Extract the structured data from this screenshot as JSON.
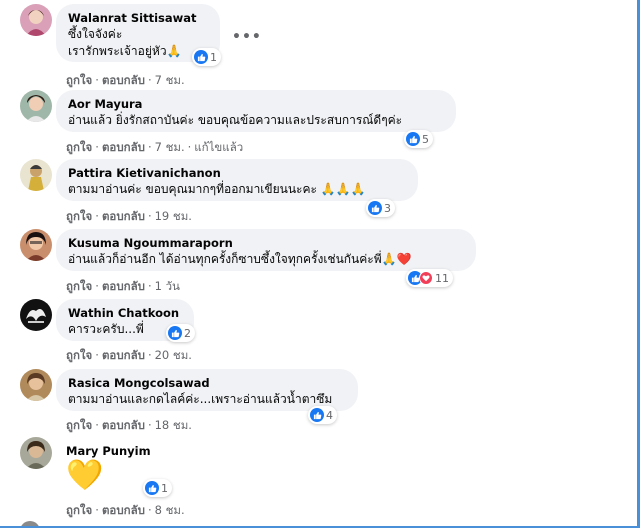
{
  "comments": [
    {
      "name": "Walanrat Sittisawat",
      "lines": [
        "ซึ้งใจจังค่ะ",
        "เรารักพระเจ้าอยู่หัว🙏"
      ],
      "reaction_count": "1",
      "actions": {
        "like": "ถูกใจ",
        "reply": "ตอบกลับ",
        "time": "7 ชม."
      }
    },
    {
      "name": "Aor Mayura",
      "lines": [
        "อ่านแล้ว ยิ่งรักสถาบันค่ะ ขอบคุณข้อความและประสบการณ์ดีๆค่ะ"
      ],
      "reaction_count": "5",
      "actions": {
        "like": "ถูกใจ",
        "reply": "ตอบกลับ",
        "time": "7 ชม.",
        "edited": "แก้ไขแล้ว"
      }
    },
    {
      "name": "Pattira Kietivanichanon",
      "lines": [
        "ตามมาอ่านค่ะ ขอบคุณมากๆที่ออกมาเขียนนะคะ 🙏🙏🙏"
      ],
      "reaction_count": "3",
      "actions": {
        "like": "ถูกใจ",
        "reply": "ตอบกลับ",
        "time": "19 ชม."
      }
    },
    {
      "name": "Kusuma Ngoummaraporn",
      "lines": [
        "อ่านแล้วก็อ่านอีก ได้อ่านทุกครั้งก็ซาบซึ้งใจทุกครั้งเช่นกันค่ะพี่🙏❤️"
      ],
      "reaction_count": "11",
      "actions": {
        "like": "ถูกใจ",
        "reply": "ตอบกลับ",
        "time": "1 วัน"
      }
    },
    {
      "name": "Wathin Chatkoon",
      "lines": [
        "คารวะครับ...พี่"
      ],
      "reaction_count": "2",
      "actions": {
        "like": "ถูกใจ",
        "reply": "ตอบกลับ",
        "time": "20 ชม."
      }
    },
    {
      "name": "Rasica Mongcolsawad",
      "lines": [
        "ตามมาอ่านและกดไลค์ค่ะ...เพราะอ่านแล้วน้ำตาซึม"
      ],
      "reaction_count": "4",
      "actions": {
        "like": "ถูกใจ",
        "reply": "ตอบกลับ",
        "time": "18 ชม."
      }
    },
    {
      "name": "Mary Punyim",
      "lines": [
        "💛"
      ],
      "reaction_count": "1",
      "actions": {
        "like": "ถูกใจ",
        "reply": "ตอบกลับ",
        "time": "8 ชม."
      }
    }
  ],
  "more_glyph": "•••",
  "separator": "·",
  "icons": {
    "like": "like-icon",
    "heart": "heart-icon",
    "care": "care-icon",
    "more": "more-options-icon"
  },
  "colors": {
    "accent": "#1877f2",
    "bubble": "#f0f2f5",
    "heart": "#f33e58",
    "meta": "#65676b",
    "frame": "#4a90d9"
  }
}
